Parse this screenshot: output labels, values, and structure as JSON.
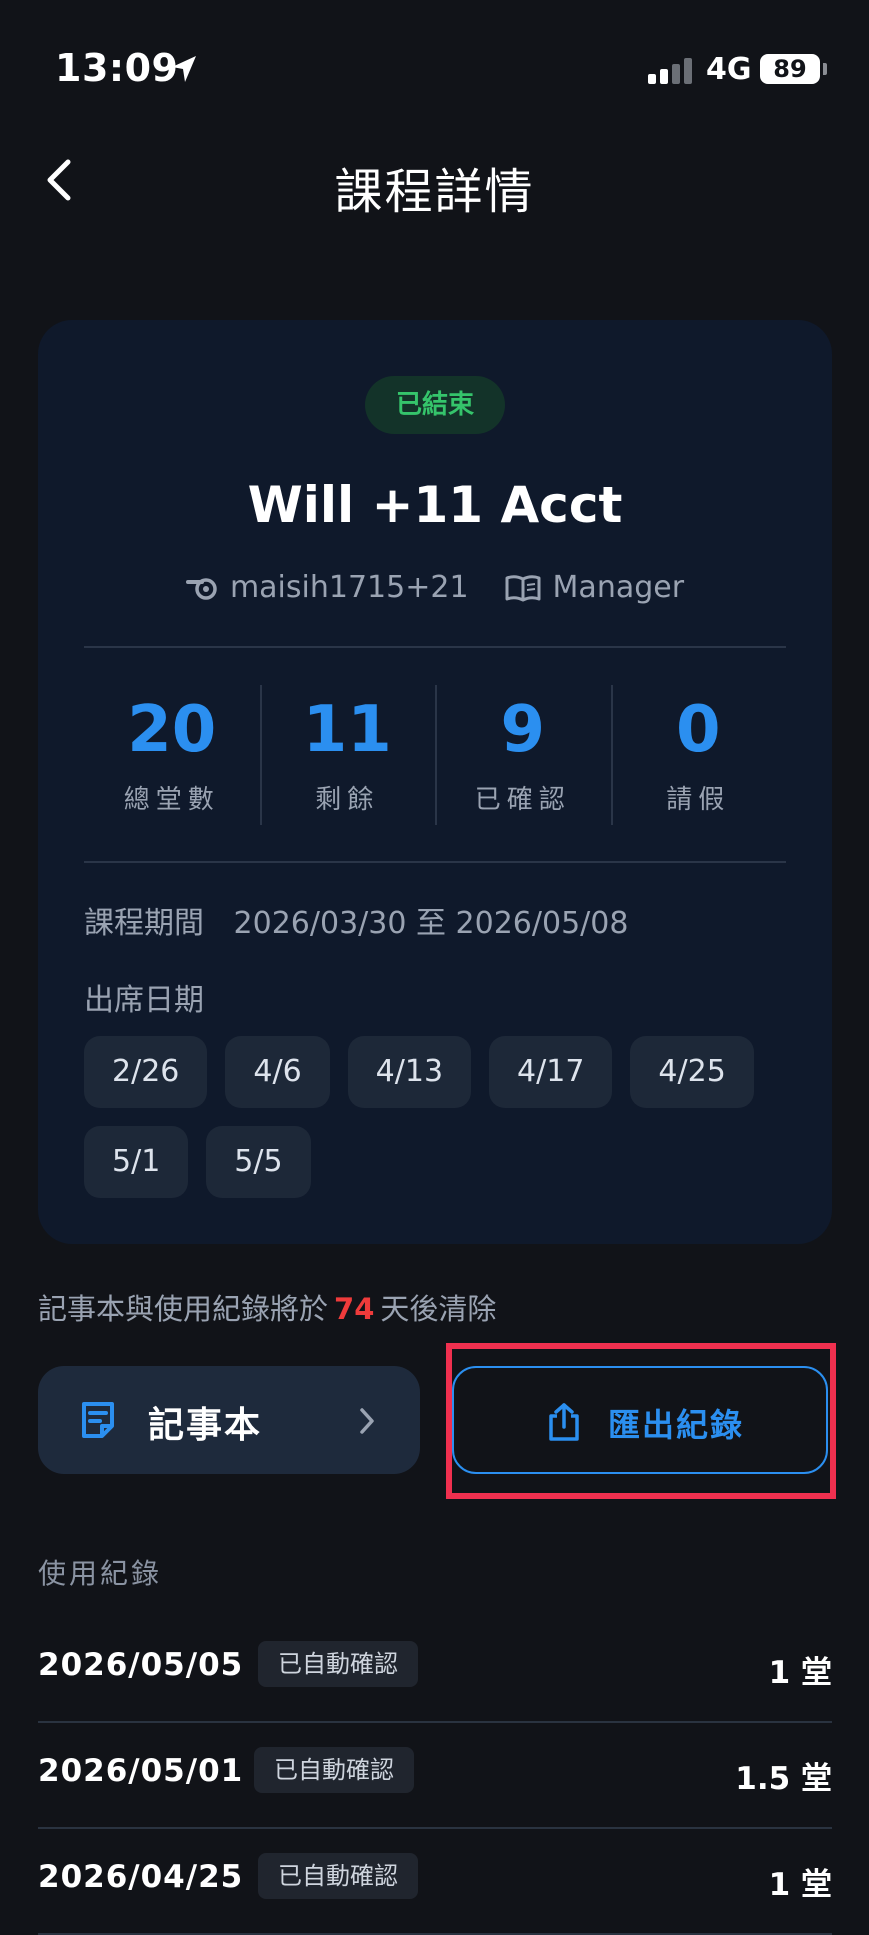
{
  "status_bar": {
    "time": "13:09",
    "network": "4G",
    "battery": "89"
  },
  "nav": {
    "title": "課程詳情"
  },
  "course": {
    "status": "已結束",
    "name": "Will +11 Acct",
    "account": "maisih1715+21",
    "role": "Manager",
    "stats": [
      {
        "value": "20",
        "label": "總堂數"
      },
      {
        "value": "11",
        "label": "剩餘"
      },
      {
        "value": "9",
        "label": "已確認"
      },
      {
        "value": "0",
        "label": "請假"
      }
    ],
    "period_label": "課程期間",
    "period_value": "2026/03/30 至 2026/05/08",
    "attendance_label": "出席日期",
    "attendance_dates": [
      "2/26",
      "4/6",
      "4/13",
      "4/17",
      "4/25",
      "5/1",
      "5/5"
    ]
  },
  "notice": {
    "prefix": "記事本與使用紀錄將於",
    "days": "74",
    "suffix": "天後清除"
  },
  "actions": {
    "notebook_label": "記事本",
    "export_label": "匯出紀錄"
  },
  "usage": {
    "title": "使用紀錄",
    "records": [
      {
        "date": "2026/05/05",
        "badge": "已自動確認",
        "amount": "1 堂"
      },
      {
        "date": "2026/05/01",
        "badge": "已自動確認",
        "amount": "1.5 堂"
      },
      {
        "date": "2026/04/25",
        "badge": "已自動確認",
        "amount": "1 堂"
      }
    ]
  },
  "colors": {
    "background": "#111318",
    "card": "#0f192b",
    "accent_blue": "#2b8ff0",
    "status_green": "#35c46b",
    "alert_red": "#ef3b3b",
    "highlight": "#f0304f"
  }
}
